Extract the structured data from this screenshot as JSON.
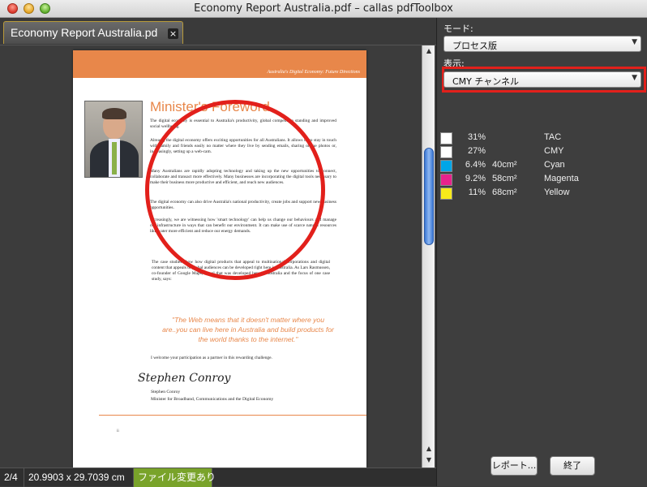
{
  "window": {
    "title": "Economy Report Australia.pdf – callas pdfToolbox"
  },
  "document_tab": {
    "label": "Economy Report Australia.pd",
    "close": "×"
  },
  "page": {
    "header_text": "Australia's Digital Economy: Future Directions",
    "title": "Minister's Foreword",
    "paragraphs": [
      "The digital economy is essential to Australia's productivity, global competitive standing and improved social wellbeing.",
      "Already, the digital economy offers exciting opportunities for all Australians. It allows us to stay in touch with family and friends easily no matter where they live by sending emails, sharing online photos or, increasingly, setting up a web-cam.",
      "Many Australians are rapidly adopting technology and taking up the new opportunities to connect, collaborate and transact more effectively. Many businesses are incorporating the digital tools necessary to make their business more productive and efficient, and reach new audiences.",
      "The digital economy can also drive Australia's national productivity, create jobs and support new business opportunities.",
      "Increasingly, we are witnessing how 'smart technology' can help us change our behaviours and manage our infrastructure in ways that can benefit our environment. It can make use of scarce natural resources like water more efficient and reduce our energy demands.",
      "The case studies show how digital products that appeal to multinational corporations and digital content that appeals to global audiences can be developed right here in Australia. As Lars Rasmussen, co-founder of Google Maps, a tool that was developed here in Australia and the focus of one case study, says:",
      "I welcome your participation as a partner in this rewarding challenge."
    ],
    "quote": "\"The Web means that it doesn't matter where you are..you can live here in Australia and build products for the world thanks to the internet.\"",
    "signature": "Stephen Conroy",
    "sign_name": "Stephen Conroy",
    "sign_role": "Minister for Broadband, Communications and the Digital Economy",
    "page_number": "ii"
  },
  "status": {
    "page": "2/4",
    "size": "20.9903 x 29.7039 cm",
    "changed": "ファイル変更あり"
  },
  "panel": {
    "mode_label": "モード:",
    "mode_value": "プロセス版",
    "display_label": "表示:",
    "display_value": "CMY チャンネル",
    "inks": [
      {
        "pct": "31%",
        "area": "",
        "name": "TAC",
        "color": "#ffffff"
      },
      {
        "pct": "27%",
        "area": "",
        "name": "CMY",
        "color": "#ffffff"
      },
      {
        "pct": "6.4%",
        "area": "40cm²",
        "name": "Cyan",
        "color": "#00a6e8"
      },
      {
        "pct": "9.2%",
        "area": "58cm²",
        "name": "Magenta",
        "color": "#e8228c"
      },
      {
        "pct": "11%",
        "area": "68cm²",
        "name": "Yellow",
        "color": "#f7ea1a"
      }
    ],
    "report_button": "レポート...",
    "finish_button": "終了"
  },
  "colors": {
    "accent": "#e8874a",
    "highlight": "#e2201b",
    "status_changed": "#79a32a"
  }
}
